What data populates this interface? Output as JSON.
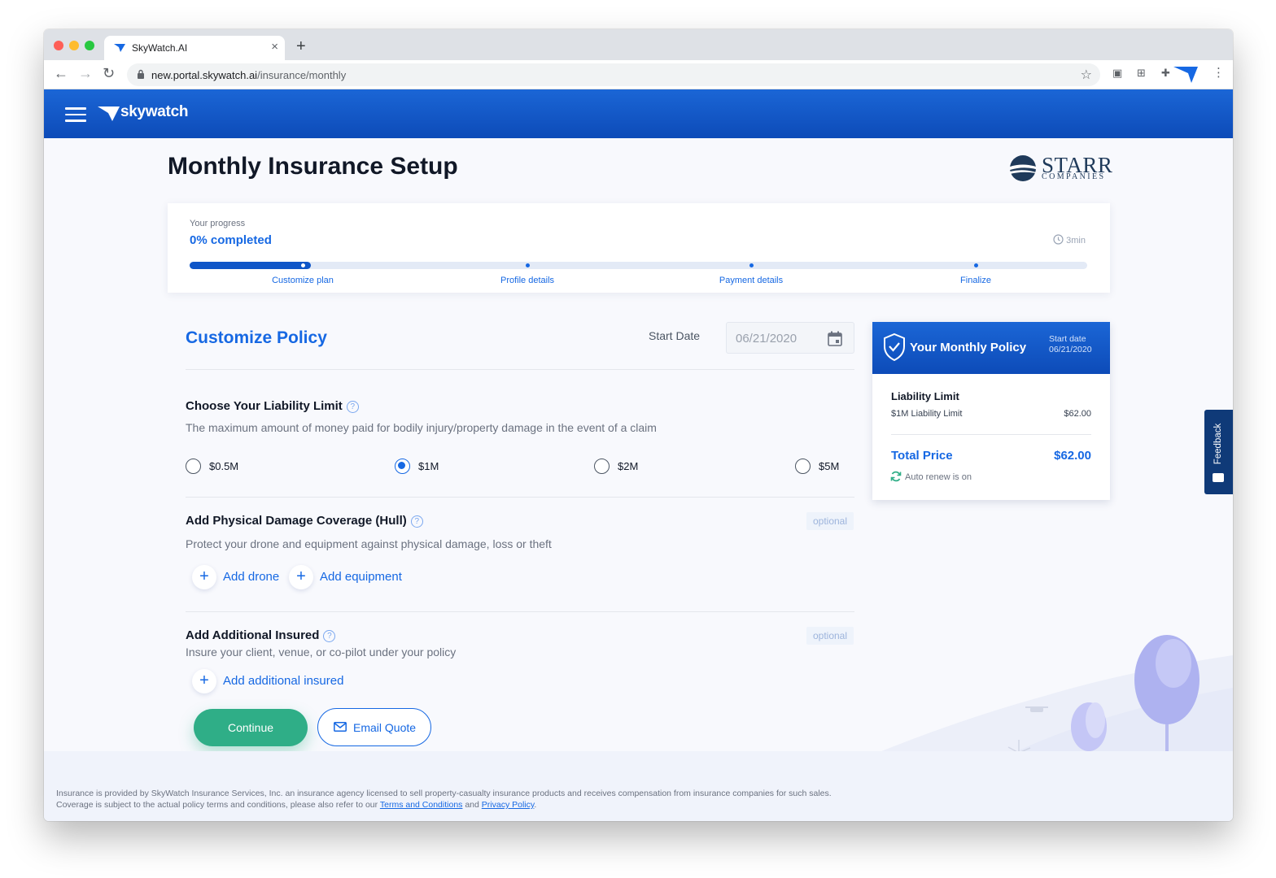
{
  "browser": {
    "tab_title": "SkyWatch.AI",
    "tab_close": "×",
    "new_tab": "+",
    "url_host": "new.portal.skywatch.ai",
    "url_path": "/insurance/monthly"
  },
  "app": {
    "brand": "skywatch"
  },
  "page": {
    "title": "Monthly Insurance Setup",
    "partner_logo": {
      "name": "STARR",
      "sub": "COMPANIES"
    }
  },
  "progress": {
    "caption": "Your progress",
    "value_text": "0% completed",
    "time_estimate": "3min",
    "fill_fraction": 0.135,
    "steps": [
      {
        "label": "Customize plan",
        "current": true
      },
      {
        "label": "Profile details",
        "current": false
      },
      {
        "label": "Payment details",
        "current": false
      },
      {
        "label": "Finalize",
        "current": false
      }
    ]
  },
  "form": {
    "section_title": "Customize Policy",
    "start_date_label": "Start Date",
    "start_date_value": "06/21/2020",
    "liability": {
      "title": "Choose Your Liability Limit",
      "description": "The maximum amount of money paid for bodily injury/property damage in the event of a claim",
      "options": [
        "$0.5M",
        "$1M",
        "$2M",
        "$5M"
      ],
      "selected": "$1M"
    },
    "hull": {
      "title": "Add Physical Damage Coverage (Hull)",
      "badge": "optional",
      "description": "Protect your drone and equipment against physical damage, loss or theft",
      "add_drone": "Add drone",
      "add_equipment": "Add equipment"
    },
    "additional_insured": {
      "title": "Add Additional Insured",
      "badge": "optional",
      "description": "Insure your client, venue, or co-pilot under your policy",
      "add_label": "Add additional insured"
    },
    "continue_label": "Continue",
    "email_quote_label": "Email Quote"
  },
  "policy_card": {
    "title": "Your Monthly Policy",
    "start_label": "Start date",
    "start_value": "06/21/2020",
    "liability_title": "Liability Limit",
    "liability_item": "$1M Liability Limit",
    "liability_price": "$62.00",
    "total_label": "Total Price",
    "total_value": "$62.00",
    "auto_renew": "Auto renew is on"
  },
  "feedback": {
    "label": "Feedback"
  },
  "footer": {
    "text_before": "Insurance is provided by SkyWatch Insurance Services, Inc. an insurance agency licensed to sell property-casualty insurance products and receives compensation from insurance companies for such sales. Coverage is subject to the actual policy terms and conditions, please also refer to our ",
    "terms_link": "Terms and Conditions",
    "and": " and ",
    "privacy_link": "Privacy Policy",
    "end": "."
  },
  "colors": {
    "primary": "#1668e3",
    "header_blue": "#0d4bb8",
    "continue_green": "#2fae87",
    "feedback_navy": "#0f3a78"
  },
  "icons": [
    "back-icon",
    "forward-icon",
    "reload-icon",
    "lock-icon",
    "star-icon",
    "menu-icon",
    "calendar-icon",
    "help-icon",
    "plus-icon",
    "mail-icon",
    "shield-check-icon",
    "refresh-icon",
    "clock-icon",
    "feedback-icon"
  ]
}
